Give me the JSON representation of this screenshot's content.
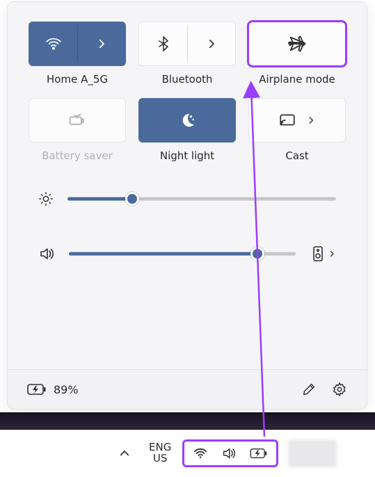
{
  "tiles": {
    "wifi": {
      "label": "Home A_5G",
      "active": true,
      "split": true
    },
    "bluetooth": {
      "label": "Bluetooth",
      "active": false,
      "split": true
    },
    "airplane": {
      "label": "Airplane mode",
      "active": false,
      "split": false,
      "highlighted": true
    },
    "battery_saver": {
      "label": "Battery saver",
      "active": false,
      "split": false,
      "disabled": true
    },
    "night_light": {
      "label": "Night light",
      "active": true,
      "split": false
    },
    "cast": {
      "label": "Cast",
      "active": false,
      "split": false,
      "chevron": true
    }
  },
  "sliders": {
    "brightness": {
      "value": 24
    },
    "volume": {
      "value": 83
    }
  },
  "footer": {
    "battery_text": "89%"
  },
  "taskbar": {
    "language_top": "ENG",
    "language_bottom": "US"
  }
}
